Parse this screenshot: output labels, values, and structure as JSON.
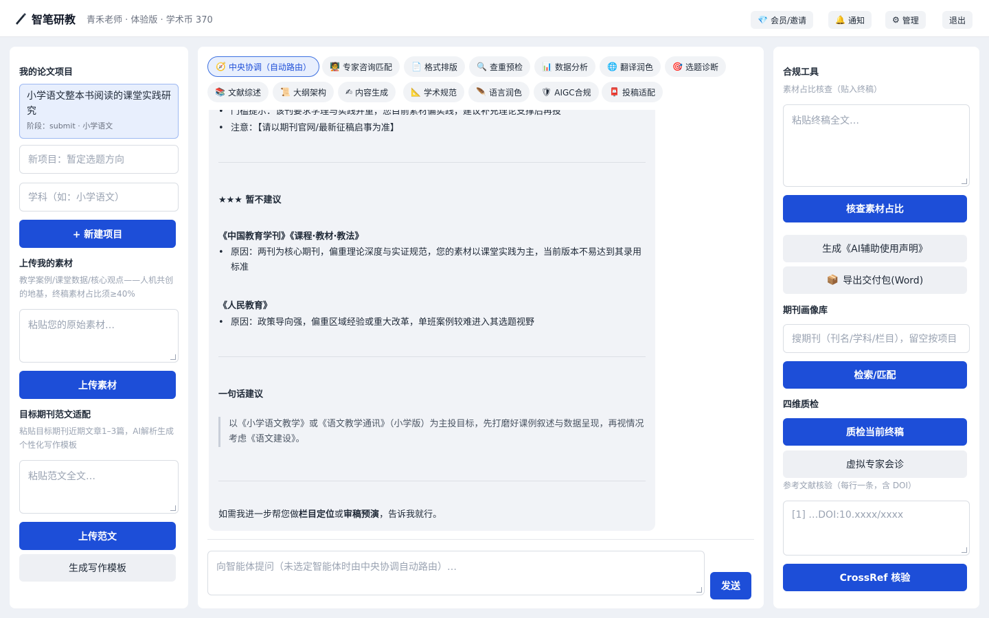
{
  "header": {
    "brand_title": "智笔研教",
    "brand_sub": "青禾老师 · 体验版 · 学术币 370",
    "buttons": {
      "vip": "会员/邀请",
      "notify": "通知",
      "admin": "管理",
      "logout": "退出"
    }
  },
  "left": {
    "projects_heading": "我的论文项目",
    "current_project": {
      "title": "小学语文整本书阅读的课堂实践研究",
      "meta": "阶段：submit · 小学语文"
    },
    "new_project_placeholder": "新项目：暂定选题方向",
    "subject_placeholder": "学科（如：小学语文）",
    "new_project_button": "+ 新建项目",
    "upload_heading": "上传我的素材",
    "upload_desc": "教学案例/课堂数据/核心观点——人机共创的地基，终稿素材占比须≥40%",
    "upload_placeholder": "粘贴您的原始素材…",
    "upload_button": "上传素材",
    "target_heading": "目标期刊范文适配",
    "target_desc": "粘贴目标期刊近期文章1–3篇，AI解析生成个性化写作模板",
    "target_placeholder": "粘贴范文全文…",
    "upload_sample_button": "上传范文",
    "generate_template_button": "生成写作模板"
  },
  "tabs": [
    {
      "label": "中央协调（自动路由）",
      "icon": "🧭",
      "active": true
    },
    {
      "label": "专家咨询匹配",
      "icon": "🧑‍🏫"
    },
    {
      "label": "格式排版",
      "icon": "📄"
    },
    {
      "label": "查重预检",
      "icon": "🔍"
    },
    {
      "label": "数据分析",
      "icon": "📊"
    },
    {
      "label": "翻译润色",
      "icon": "🌐"
    },
    {
      "label": "选题诊断",
      "icon": "🎯"
    },
    {
      "label": "文献综述",
      "icon": "📚"
    },
    {
      "label": "大纲架构",
      "icon": "📜"
    },
    {
      "label": "内容生成",
      "icon": "✍"
    },
    {
      "label": "学术规范",
      "icon": "📐"
    },
    {
      "label": "语言润色",
      "icon": "🪶"
    },
    {
      "label": "AIGC合规",
      "icon": "🛡"
    },
    {
      "label": "投稿适配",
      "icon": "📮"
    }
  ],
  "chat": {
    "cut_line": "门槛提示：该刊要求学理与实践并重，您目前素材偏实践，建议补充理论支撑后再投",
    "note_line": "注意：【请以期刊官网/最新征稿启事为准】",
    "section_heading": "★★★ 暂不建议",
    "journal_1": "《中国教育学刊》《课程·教材·教法》",
    "journal_1_reason": "原因：两刊为核心期刊，偏重理论深度与实证规范，您的素材以课堂实践为主，当前版本不易达到其录用标准",
    "journal_2": "《人民教育》",
    "journal_2_reason": "原因：政策导向强，偏重区域经验或重大改革，单班案例较难进入其选题视野",
    "summary_heading": "一句话建议",
    "summary_text": "以《小学语文教学》或《语文教学通讯》（小学版）为主投目标，先打磨好课例叙述与数据呈现，再视情况考虑《语文建设》。",
    "footer_pre": "如需我进一步帮您做",
    "footer_b1": "栏目定位",
    "footer_mid": "或",
    "footer_b2": "审稿预演",
    "footer_post": "，告诉我就行。"
  },
  "composer": {
    "placeholder": "向智能体提问（未选定智能体时由中央协调自动路由）…",
    "send": "发送"
  },
  "right": {
    "compliance_heading": "合规工具",
    "compliance_desc": "素材占比核查（贴入终稿）",
    "final_placeholder": "粘贴终稿全文…",
    "check_button": "核查素材占比",
    "ai_statement_button": "生成《AI辅助使用声明》",
    "export_button": "导出交付包(Word)",
    "journal_heading": "期刊画像库",
    "journal_placeholder": "搜期刊（刊名/学科/栏目），留空按项目",
    "search_button": "检索/匹配",
    "quality_heading": "四维质检",
    "quality_button": "质检当前终稿",
    "expert_button": "虚拟专家会诊",
    "ref_desc": "参考文献核验（每行一条，含 DOI）",
    "ref_placeholder": "[1] …DOI:10.xxxx/xxxx",
    "crossref_button": "CrossRef 核验"
  }
}
